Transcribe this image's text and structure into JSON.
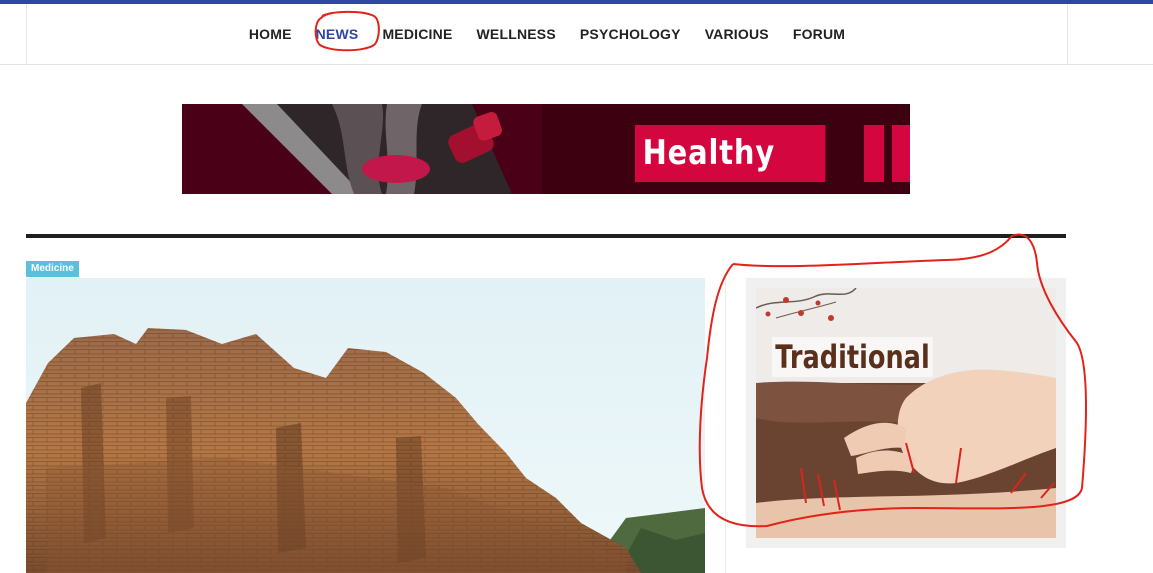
{
  "nav": {
    "items": [
      "HOME",
      "NEWS",
      "MEDICINE",
      "WELLNESS",
      "PSYCHOLOGY",
      "VARIOUS",
      "FORUM"
    ],
    "active": "NEWS"
  },
  "banner": {
    "text": "Healthy"
  },
  "article": {
    "category": "Medicine"
  },
  "sidebar_ad": {
    "text": "Traditional"
  },
  "colors": {
    "accent": "#2f47a3",
    "banner_red": "#d4063f",
    "category_badge": "#5bc0de",
    "annotation_red": "#e2231a"
  }
}
